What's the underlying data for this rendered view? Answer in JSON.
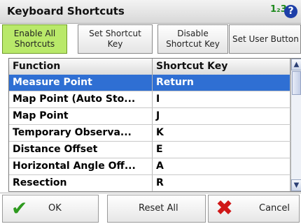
{
  "title": "Keyboard Shortcuts",
  "input_mode": "1₂3",
  "help_icon": "?",
  "toolbar": [
    {
      "label": "Enable All\nShortcuts",
      "active": true
    },
    {
      "label": "Set Shortcut\nKey",
      "active": false
    },
    {
      "label": "Disable\nShortcut Key",
      "active": false
    },
    {
      "label": "Set User Button",
      "active": false
    }
  ],
  "table": {
    "headers": [
      "Function",
      "Shortcut Key"
    ],
    "rows": [
      {
        "function": "Measure Point",
        "key": "Return",
        "selected": true
      },
      {
        "function": "Map Point (Auto Sto...",
        "key": "I"
      },
      {
        "function": "Map Point",
        "key": "J"
      },
      {
        "function": "Temporary Observa...",
        "key": "K"
      },
      {
        "function": "Distance Offset",
        "key": "E"
      },
      {
        "function": "Horizontal Angle Off...",
        "key": "A"
      },
      {
        "function": "Resection",
        "key": "R"
      }
    ]
  },
  "scroll": {
    "up": "▲",
    "down": "▼"
  },
  "buttons": {
    "ok": "OK",
    "reset": "Reset All",
    "cancel": "Cancel"
  },
  "icons": {
    "ok": "check-icon",
    "cancel": "x-icon"
  },
  "colors": {
    "selection": "#2f6fd3",
    "active_button": "#b9e96a",
    "ok_check": "#2e9a1f",
    "cancel_x": "#d01818",
    "help": "#1d3fa8"
  }
}
